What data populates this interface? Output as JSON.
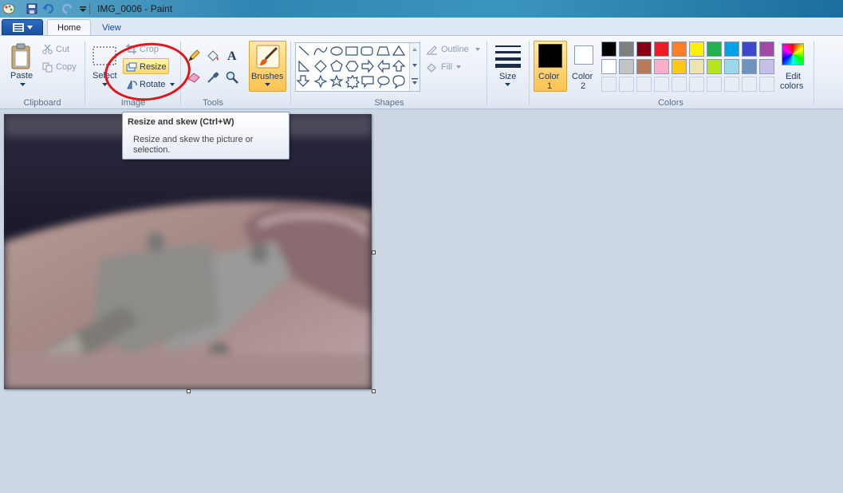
{
  "window": {
    "title": "IMG_0006 - Paint"
  },
  "tabs": [
    {
      "label": "Home",
      "active": true
    },
    {
      "label": "View",
      "active": false
    }
  ],
  "clipboard": {
    "group_label": "Clipboard",
    "paste": "Paste",
    "cut": "Cut",
    "copy": "Copy"
  },
  "image": {
    "group_label": "Image",
    "select": "Select",
    "crop": "Crop",
    "resize": "Resize",
    "rotate": "Rotate"
  },
  "tools": {
    "group_label": "Tools",
    "items": [
      "pencil-icon",
      "fill-icon",
      "text-icon",
      "eraser-icon",
      "color-picker-icon",
      "magnifier-icon"
    ]
  },
  "brushes": {
    "label": "Brushes"
  },
  "shapes": {
    "group_label": "Shapes",
    "outline": "Outline",
    "fill": "Fill"
  },
  "size": {
    "label": "Size"
  },
  "colors": {
    "group_label": "Colors",
    "color1_line1": "Color",
    "color1_line2": "1",
    "color2_line1": "Color",
    "color2_line2": "2",
    "edit_line1": "Edit",
    "edit_line2": "colors",
    "color1_value": "#000000",
    "color2_value": "#ffffff",
    "palette_row1": [
      "#000000",
      "#7f7f7f",
      "#880015",
      "#ed1c24",
      "#ff7f27",
      "#fff200",
      "#22b14c",
      "#00a2e8",
      "#3f48cc",
      "#a349a4"
    ],
    "palette_row2": [
      "#ffffff",
      "#c3c3c3",
      "#b97a57",
      "#ffaec9",
      "#ffc90e",
      "#efe4b0",
      "#b5e61d",
      "#99d9ea",
      "#7092be",
      "#c8bfe7"
    ]
  },
  "tooltip": {
    "title": "Resize and skew (Ctrl+W)",
    "body": "Resize and skew the picture or selection."
  }
}
